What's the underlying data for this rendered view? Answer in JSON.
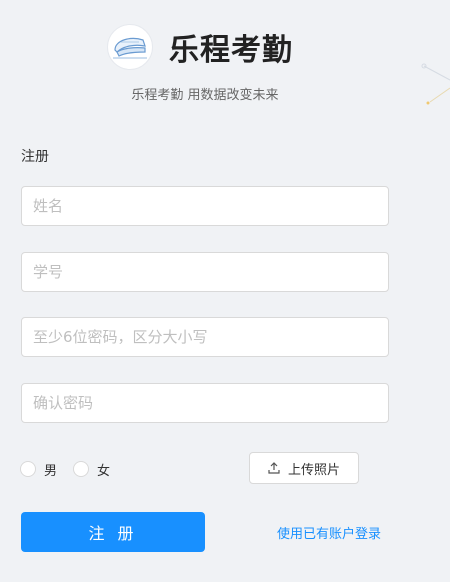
{
  "brand": {
    "title": "乐程考勤",
    "subtitle": "乐程考勤 用数据改变未来"
  },
  "form": {
    "heading": "注册",
    "name_placeholder": "姓名",
    "student_id_placeholder": "学号",
    "password_placeholder": "至少6位密码，区分大小写",
    "confirm_password_placeholder": "确认密码",
    "gender_options": [
      "男",
      "女"
    ],
    "upload_label": "上传照片",
    "submit_label": "注 册",
    "login_link": "使用已有账户登录"
  },
  "colors": {
    "primary": "#1890ff",
    "background": "#f0f2f5"
  }
}
